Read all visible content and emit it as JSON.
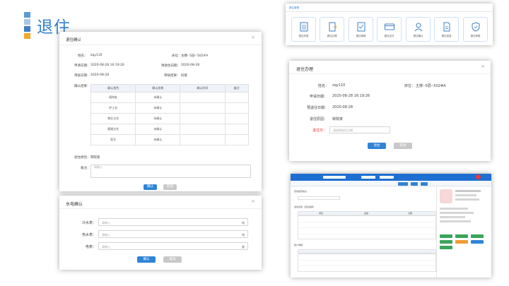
{
  "slide": {
    "title": "退住",
    "bar_colors": [
      "#5b9bd5",
      "#a9c6e8",
      "#3c7fc7",
      "#f2a829"
    ]
  },
  "confirm_dialog": {
    "title": "退住确认",
    "close": "×",
    "name_label": "姓名：",
    "name_value": "zqy110",
    "bed_label": "床位：",
    "bed_value": "主楼--5层--502#A",
    "apply_date_label": "申请日期：",
    "apply_date_value": "2020-08-28 16:19:26",
    "planned_date_label": "预退住日期：",
    "planned_date_value": "2020-08-28",
    "review_date_label": "审核日期：",
    "review_date_value": "2020-08-28",
    "review_result_label": "审核结果：",
    "review_result_value": "同意",
    "confirm_result_label": "确认结果：",
    "table_headers": [
      "确认角色",
      "确认结果",
      "确认时间",
      "备注"
    ],
    "table_rows": [
      [
        "接待处",
        "未确认",
        "",
        ""
      ],
      [
        "护士长",
        "未确认",
        "",
        ""
      ],
      [
        "物业主任",
        "未确认",
        "",
        ""
      ],
      [
        "客服主任",
        "未确认",
        "",
        ""
      ],
      [
        "医生",
        "未确认",
        "",
        ""
      ]
    ],
    "reason_label": "退住原因：",
    "reason_value": "转院家",
    "remark_label": "备注：",
    "remark_placeholder": "请输入",
    "ok": "确认",
    "cancel": "取消"
  },
  "management": {
    "title": "退住管理",
    "items": [
      {
        "label": "退住列表",
        "icon": "list-icon"
      },
      {
        "label": "退住办理",
        "icon": "document-out-icon"
      },
      {
        "label": "退住审核",
        "icon": "checklist-icon"
      },
      {
        "label": "退住支付",
        "icon": "card-icon"
      },
      {
        "label": "退住确认",
        "icon": "user-confirm-icon"
      },
      {
        "label": "退住信息",
        "icon": "file-info-icon"
      },
      {
        "label": "退住审核",
        "icon": "shield-icon"
      }
    ]
  },
  "process_dialog": {
    "title": "退住办理",
    "close": "×",
    "name_label": "姓名：",
    "name_value": "zqy110",
    "bed_label": "床位：",
    "bed_value": "主楼--5层--502#A",
    "apply_date_label": "申请日期：",
    "apply_date_value": "2020-08-28 16:19:26",
    "planned_date_label": "预退住日期：",
    "planned_date_value": "2020-08-28",
    "reason_label": "退住原因：",
    "reason_value": "转院家",
    "date_label": "退住日：",
    "date_placeholder": "请选择退住日期",
    "ok": "退住",
    "cancel": "取消"
  },
  "utility_dialog": {
    "title": "水电确认",
    "close": "×",
    "fields": [
      {
        "label": "冷水表：",
        "placeholder": "请输入",
        "unit": "吨"
      },
      {
        "label": "热水表：",
        "placeholder": "请输入",
        "unit": "吨"
      },
      {
        "label": "电表：",
        "placeholder": "请输入",
        "unit": "度"
      }
    ],
    "ok": "确认",
    "cancel": "取消"
  },
  "detail_screen": {
    "section_a": "费用结算信息",
    "section_b": "退住费用（退款金额）",
    "section_c": "账户明细",
    "col_a": "项目",
    "col_b": "金额",
    "col_c": "日期"
  },
  "colors": {
    "accent": "#2f84d6",
    "title_blue": "#2d7fd1",
    "required_red": "#e23b3b"
  }
}
